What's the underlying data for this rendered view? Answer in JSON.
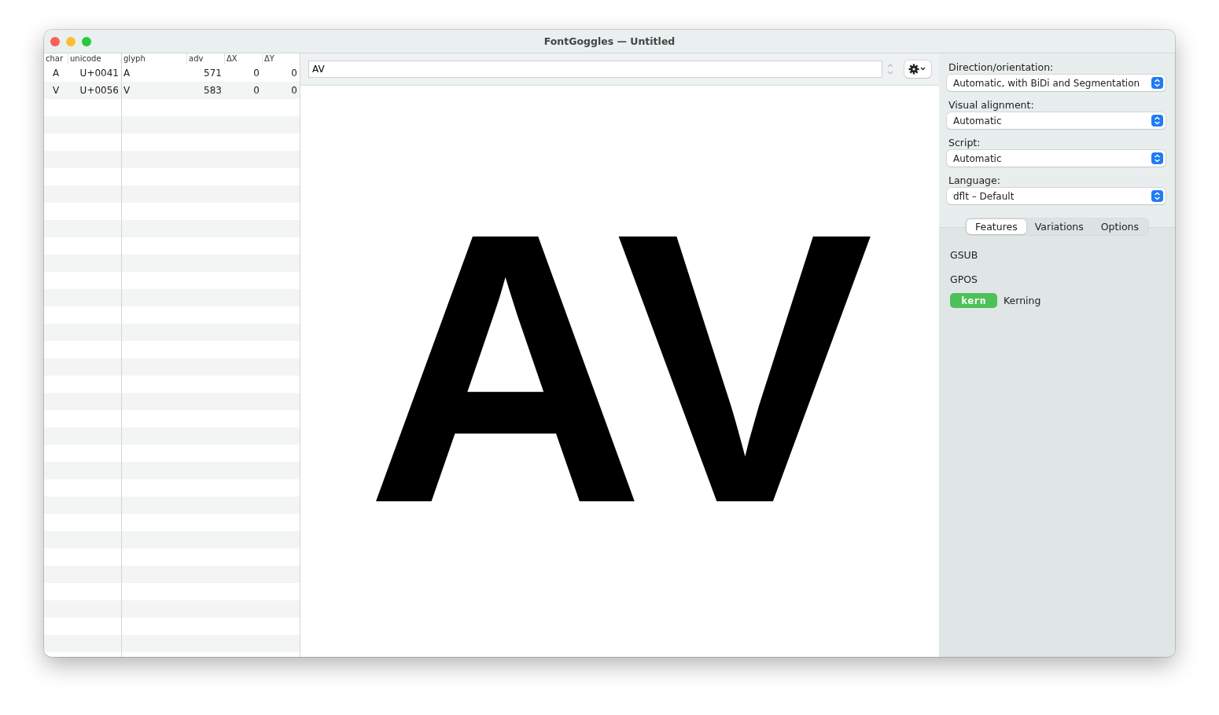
{
  "window": {
    "title": "FontGoggles — Untitled"
  },
  "glyph_table": {
    "columns": [
      "char",
      "unicode",
      "glyph",
      "adv",
      "ΔX",
      "ΔY"
    ],
    "rows": [
      [
        "A",
        "U+0041",
        "A",
        "571",
        "0",
        "0"
      ],
      [
        "V",
        "U+0056",
        "V",
        "583",
        "0",
        "0"
      ]
    ]
  },
  "text_field": {
    "value": "AV"
  },
  "preview": {
    "text": "AV"
  },
  "settings": [
    {
      "label": "Direction/orientation:",
      "value": "Automatic, with BiDi and Segmentation"
    },
    {
      "label": "Visual alignment:",
      "value": "Automatic"
    },
    {
      "label": "Script:",
      "value": "Automatic"
    },
    {
      "label": "Language:",
      "value": "dflt – Default"
    }
  ],
  "tabs": [
    {
      "label": "Features",
      "selected": true
    },
    {
      "label": "Variations",
      "selected": false
    },
    {
      "label": "Options",
      "selected": false
    }
  ],
  "features": {
    "gsub_title": "GSUB",
    "gpos_title": "GPOS",
    "gpos": [
      {
        "tag": "kern",
        "name": "Kerning",
        "on": true
      }
    ]
  }
}
